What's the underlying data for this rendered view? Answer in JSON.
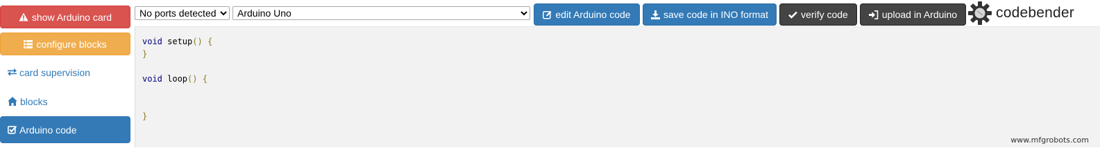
{
  "sidebar": {
    "show_card": {
      "label": "show Arduino card",
      "icon": "warning-icon",
      "color": "#d9534f"
    },
    "configure_blocks": {
      "label": "configure blocks",
      "icon": "list-icon",
      "color": "#f0ad4e"
    },
    "card_supervision": {
      "label": "card supervision",
      "icon": "exchange-icon"
    },
    "blocks": {
      "label": "blocks",
      "icon": "home-icon"
    },
    "arduino_code": {
      "label": "Arduino code",
      "icon": "check-square-icon",
      "color": "#337ab7",
      "active": true
    }
  },
  "toolbar": {
    "ports_select": {
      "value": "No ports detected",
      "options": [
        "No ports detected"
      ]
    },
    "board_select": {
      "value": "Arduino Uno",
      "options": [
        "Arduino Uno"
      ]
    },
    "edit_button": {
      "label": "edit Arduino code",
      "icon": "edit-icon"
    },
    "save_button": {
      "label": "save code in INO format",
      "icon": "download-icon"
    },
    "verify_button": {
      "label": "verify code",
      "icon": "check-icon"
    },
    "upload_button": {
      "label": "upload in Arduino",
      "icon": "sign-in-icon"
    },
    "logo_text": "codebender"
  },
  "editor": {
    "lines": [
      {
        "kw": "void",
        "fn": " setup",
        "br": "() {"
      },
      {
        "kw": "",
        "fn": "",
        "br": "}"
      },
      {
        "kw": "",
        "fn": "",
        "br": ""
      },
      {
        "kw": "void",
        "fn": " loop",
        "br": "() {"
      },
      {
        "kw": "",
        "fn": "",
        "br": ""
      },
      {
        "kw": "",
        "fn": "",
        "br": ""
      },
      {
        "kw": "",
        "fn": "",
        "br": "}"
      }
    ]
  },
  "watermark": "www.mfgrobots.com"
}
